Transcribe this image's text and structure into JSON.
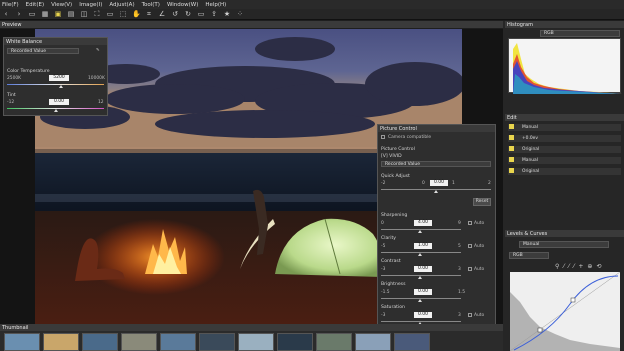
{
  "menu": [
    "File(F)",
    "Edit(E)",
    "View(V)",
    "Image(I)",
    "Adjust(A)",
    "Tool(T)",
    "Window(W)",
    "Help(H)"
  ],
  "preview": {
    "title": "Preview"
  },
  "thumbnail": {
    "title": "Thumbnail"
  },
  "white_balance": {
    "title": "White Balance",
    "mode": "Recorded Value",
    "color_temp_label": "Color Temperature",
    "temp_min": "2500K",
    "temp_value": "5200",
    "temp_max": "10000K",
    "tint_label": "Tint",
    "tint_min": "-12",
    "tint_value": "0.00",
    "tint_max": "12"
  },
  "picture_control": {
    "title": "Picture Control",
    "camera_compatible": "Camera compatible",
    "section_label": "Picture Control",
    "current_profile": "[V] VIVID",
    "mode": "Recorded Value",
    "quick_adjust_label": "Quick Adjust",
    "quick_adjust_min": "-2",
    "quick_adjust_mid": "0",
    "quick_adjust_value": "0.00",
    "quick_adjust_one": "1",
    "quick_adjust_max": "2",
    "reset_label": "Reset",
    "auto_label": "Auto",
    "sliders": [
      {
        "label": "Sharpening",
        "min": "0",
        "value": "4.00",
        "max": "9",
        "auto": true
      },
      {
        "label": "Clarity",
        "min": "-5",
        "value": "1.00",
        "max": "5",
        "auto": true
      },
      {
        "label": "Contrast",
        "min": "-3",
        "value": "0.00",
        "max": "3",
        "auto": true
      },
      {
        "label": "Brightness",
        "min": "-1.5",
        "value": "0.00",
        "max": "1.5",
        "auto": false
      },
      {
        "label": "Saturation",
        "min": "-3",
        "value": "0.00",
        "max": "3",
        "auto": true
      },
      {
        "label": "Hue",
        "min": "-3",
        "value": "0.00",
        "max": "3",
        "auto": false
      }
    ]
  },
  "histogram": {
    "title": "Histogram",
    "channel": "RGB"
  },
  "edit": {
    "title": "Edit",
    "rows": [
      "Manual",
      "+0.0ev",
      "Original",
      "Manual",
      "Original"
    ]
  },
  "levels": {
    "title": "Levels & Curves",
    "mode": "Manual",
    "channel": "RGB"
  },
  "colors": {
    "panel_header": "#3a3a3a",
    "accent_yellow": "#e8d44d",
    "curve_blue": "#3b5fd9"
  }
}
